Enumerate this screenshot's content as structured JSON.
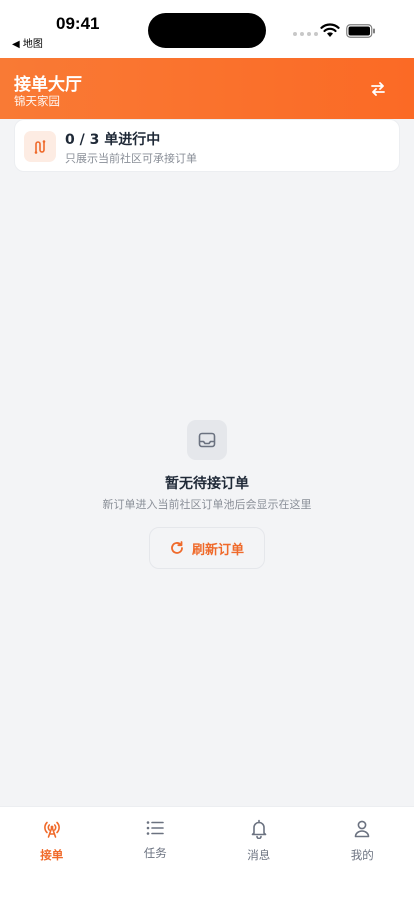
{
  "status_bar": {
    "time": "09:41",
    "back_app": "◀ 地图"
  },
  "header": {
    "title": "接单大厅",
    "subtitle": "锦天家园",
    "switch_icon": "swap-arrows-icon"
  },
  "progress": {
    "title": "0 / 3 单进行中",
    "subtitle": "只展示当前社区可承接订单",
    "icon": "route-icon"
  },
  "empty_state": {
    "icon": "inbox-icon",
    "title": "暂无待接订单",
    "description": "新订单进入当前社区订单池后会显示在这里",
    "refresh_label": "刷新订单"
  },
  "tabbar": {
    "items": [
      {
        "label": "接单",
        "icon": "broadcast-icon",
        "active": true
      },
      {
        "label": "任务",
        "icon": "list-icon",
        "active": false
      },
      {
        "label": "消息",
        "icon": "bell-icon",
        "active": false
      },
      {
        "label": "我的",
        "icon": "user-icon",
        "active": false
      }
    ]
  },
  "colors": {
    "accent": "#f06a2a",
    "header_start": "#f97a35",
    "header_end": "#fb6a25",
    "background": "#f3f4f6"
  }
}
